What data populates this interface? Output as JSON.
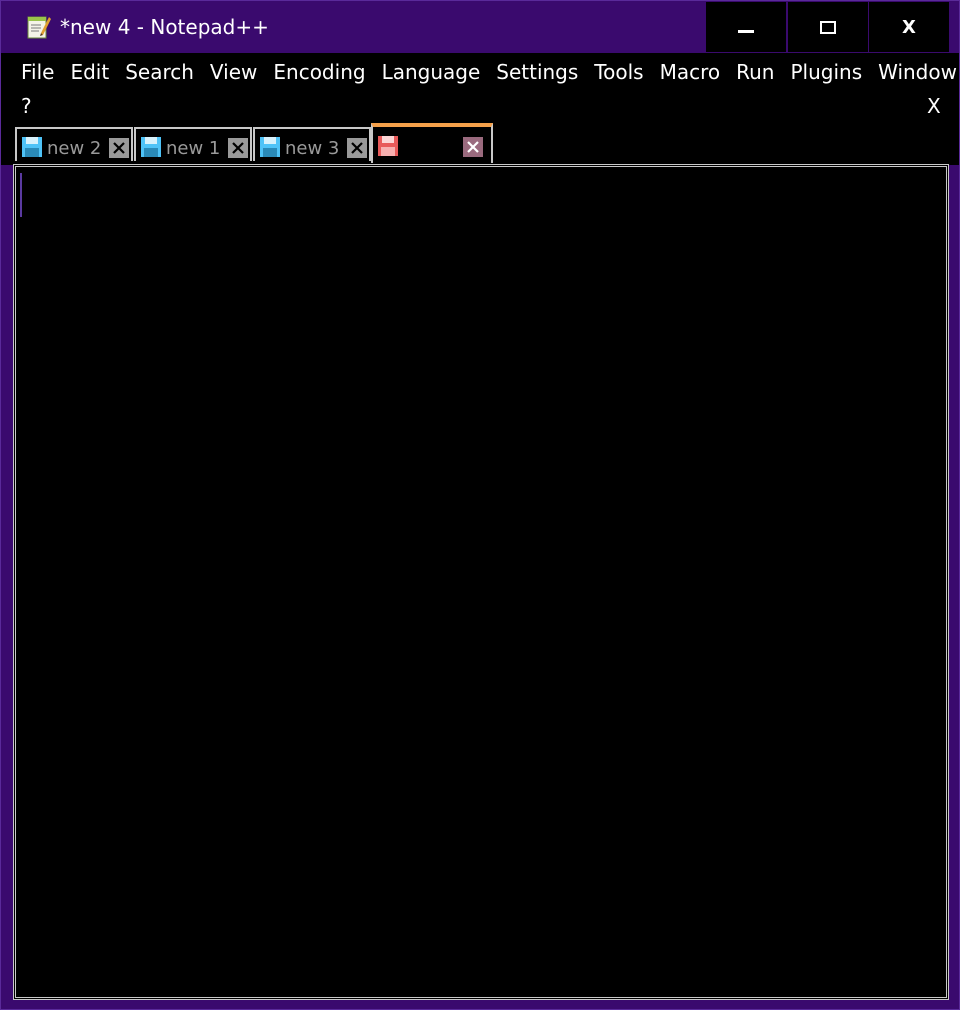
{
  "window": {
    "title": "*new 4 - Notepad++",
    "icon": "notepadpp-app-icon",
    "controls": {
      "minimize": "minimize-icon",
      "maximize": "maximize-icon",
      "close_label": "X"
    }
  },
  "menubar": {
    "items": [
      {
        "label": "File"
      },
      {
        "label": "Edit"
      },
      {
        "label": "Search"
      },
      {
        "label": "View"
      },
      {
        "label": "Encoding"
      },
      {
        "label": "Language"
      },
      {
        "label": "Settings"
      },
      {
        "label": "Tools"
      },
      {
        "label": "Macro"
      },
      {
        "label": "Run"
      },
      {
        "label": "Plugins"
      },
      {
        "label": "Window"
      }
    ],
    "help_label": "?",
    "close_document_label": "X"
  },
  "tabs": [
    {
      "label": "new 2",
      "saved": true,
      "active": false
    },
    {
      "label": "new 1",
      "saved": true,
      "active": false
    },
    {
      "label": "new 3",
      "saved": true,
      "active": false
    },
    {
      "label": "",
      "saved": false,
      "active": true
    }
  ],
  "editor": {
    "content": ""
  },
  "colors": {
    "title_bar": "#3a0a6e",
    "background": "#000000",
    "active_tab_accent": "#f5a04a",
    "saved_disk": "#4fc3f7",
    "unsaved_disk": "#e85a5a",
    "text": "#ffffff",
    "inactive_tab_text": "#9a9a9a"
  }
}
